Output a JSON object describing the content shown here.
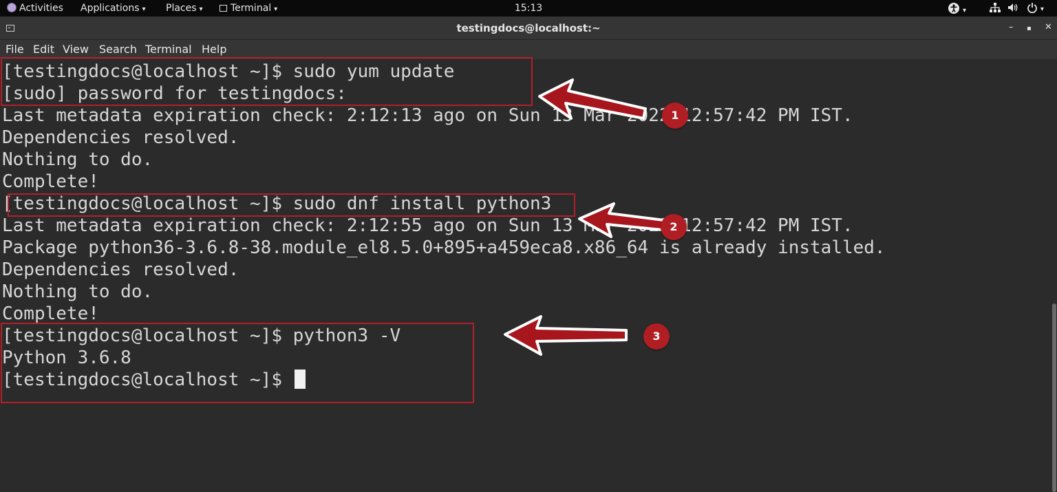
{
  "topbar": {
    "activities": "Activities",
    "applications": "Applications",
    "places": "Places",
    "terminal": "Terminal",
    "clock": "15:13",
    "caret": "▾",
    "icons": [
      "accessibility-icon",
      "network-icon",
      "volume-icon",
      "power-icon"
    ]
  },
  "window": {
    "title": "testingdocs@localhost:~",
    "minimize": "–",
    "maximize": "▪",
    "close": "✕"
  },
  "menu": {
    "file": "File",
    "edit": "Edit",
    "view": "View",
    "search": "Search",
    "terminal": "Terminal",
    "help": "Help"
  },
  "terminal": {
    "lines": [
      "[testingdocs@localhost ~]$ sudo yum update",
      "[sudo] password for testingdocs:",
      "Last metadata expiration check: 2:12:13 ago on Sun 13 Mar 2022 12:57:42 PM IST.",
      "Dependencies resolved.",
      "Nothing to do.",
      "Complete!",
      "[testingdocs@localhost ~]$ sudo dnf install python3",
      "Last metadata expiration check: 2:12:55 ago on Sun 13 Mar 2022 12:57:42 PM IST.",
      "Package python36-3.6.8-38.module_el8.5.0+895+a459eca8.x86_64 is already installed.",
      "Dependencies resolved.",
      "Nothing to do.",
      "Complete!",
      "[testingdocs@localhost ~]$ python3 -V",
      "Python 3.6.8",
      "[testingdocs@localhost ~]$ "
    ]
  },
  "annotations": {
    "badge1": "1",
    "badge2": "2",
    "badge3": "3",
    "color": "#b01e24"
  },
  "colors": {
    "terminal_bg": "#2b2b2b",
    "terminal_fg": "#d7d7d7",
    "chrome_bg": "#353535",
    "topbar_bg": "#0a0a0a"
  }
}
